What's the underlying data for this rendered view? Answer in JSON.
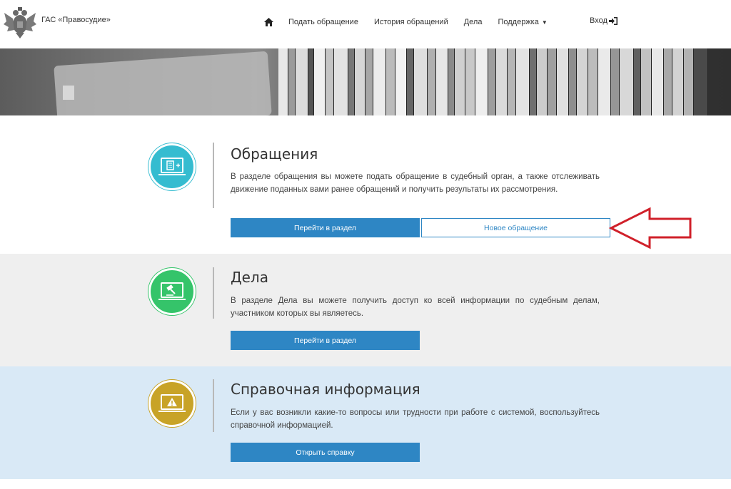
{
  "header": {
    "brand": "ГАС «Правосудие»",
    "nav": [
      {
        "label": "Подать обращение"
      },
      {
        "label": "История обращений"
      },
      {
        "label": "Дела"
      },
      {
        "label": "Поддержка"
      }
    ],
    "login": "Вход",
    "icons": {
      "home": "home-icon",
      "login": "sign-in-icon",
      "dropdown": "caret-down-icon",
      "logo": "emblem-icon"
    }
  },
  "sections": [
    {
      "title": "Обращения",
      "description": "В разделе обращения вы можете подать обращение в судебный орган, а также отслеживать движение поданных вами ранее обращений и получить результаты их рассмотрения.",
      "primary_button": "Перейти в раздел",
      "secondary_button": "Новое обращение",
      "icon": "laptop-document-icon",
      "color": "#35bcd0"
    },
    {
      "title": "Дела",
      "description": "В разделе Дела вы можете получить доступ ко всей информации по судебным делам, участником которых вы являетесь.",
      "primary_button": "Перейти в раздел",
      "icon": "laptop-gavel-icon",
      "color": "#35c46a"
    },
    {
      "title": "Справочная информация",
      "description": "Если у вас возникли какие-то вопросы или трудности при работе с системой, воспользуйтесь справочной информацией.",
      "primary_button": "Открыть справку",
      "icon": "laptop-warning-icon",
      "color": "#c8a327"
    }
  ],
  "colors": {
    "accent": "#2e86c4",
    "arrow": "#d0202a"
  }
}
